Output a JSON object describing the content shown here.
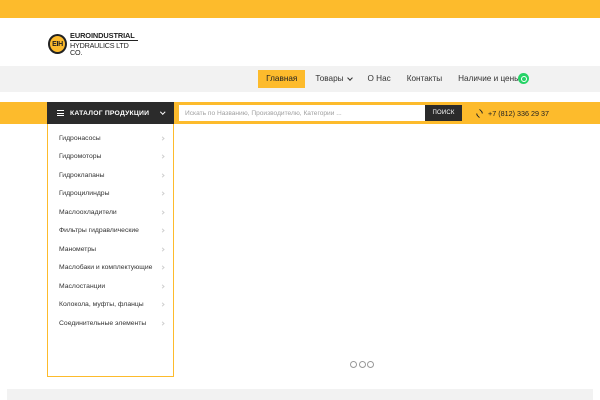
{
  "colors": {
    "accent": "#fdbb2c",
    "dark": "#2b2b2b",
    "whatsapp": "#25d366"
  },
  "logo": {
    "mark": "EIH",
    "line1": "EUROINDUSTRIAL",
    "line2": "HYDRAULICS LTD CO."
  },
  "nav": {
    "home": "Главная",
    "products": "Товары",
    "about": "О Нас",
    "contacts": "Контакты",
    "availability": "Наличие и цены",
    "whatsapp_icon": "whatsapp-icon"
  },
  "catalog": {
    "label": "КАТАЛОГ ПРОДУКЦИИ",
    "items": [
      "Гидронасосы",
      "Гидромоторы",
      "Гидроклапаны",
      "Гидроцилиндры",
      "Маслоохладители",
      "Фильтры гидравлические",
      "Манометры",
      "Маслобаки и комплектующие",
      "Маслостанции",
      "Колокола, муфты, фланцы",
      "Соединительные элементы"
    ]
  },
  "search": {
    "placeholder": "Искать по Названию, Производителю, Категории ...",
    "button": "ПОИСК"
  },
  "phone": "+7 (812) 336 29 37"
}
